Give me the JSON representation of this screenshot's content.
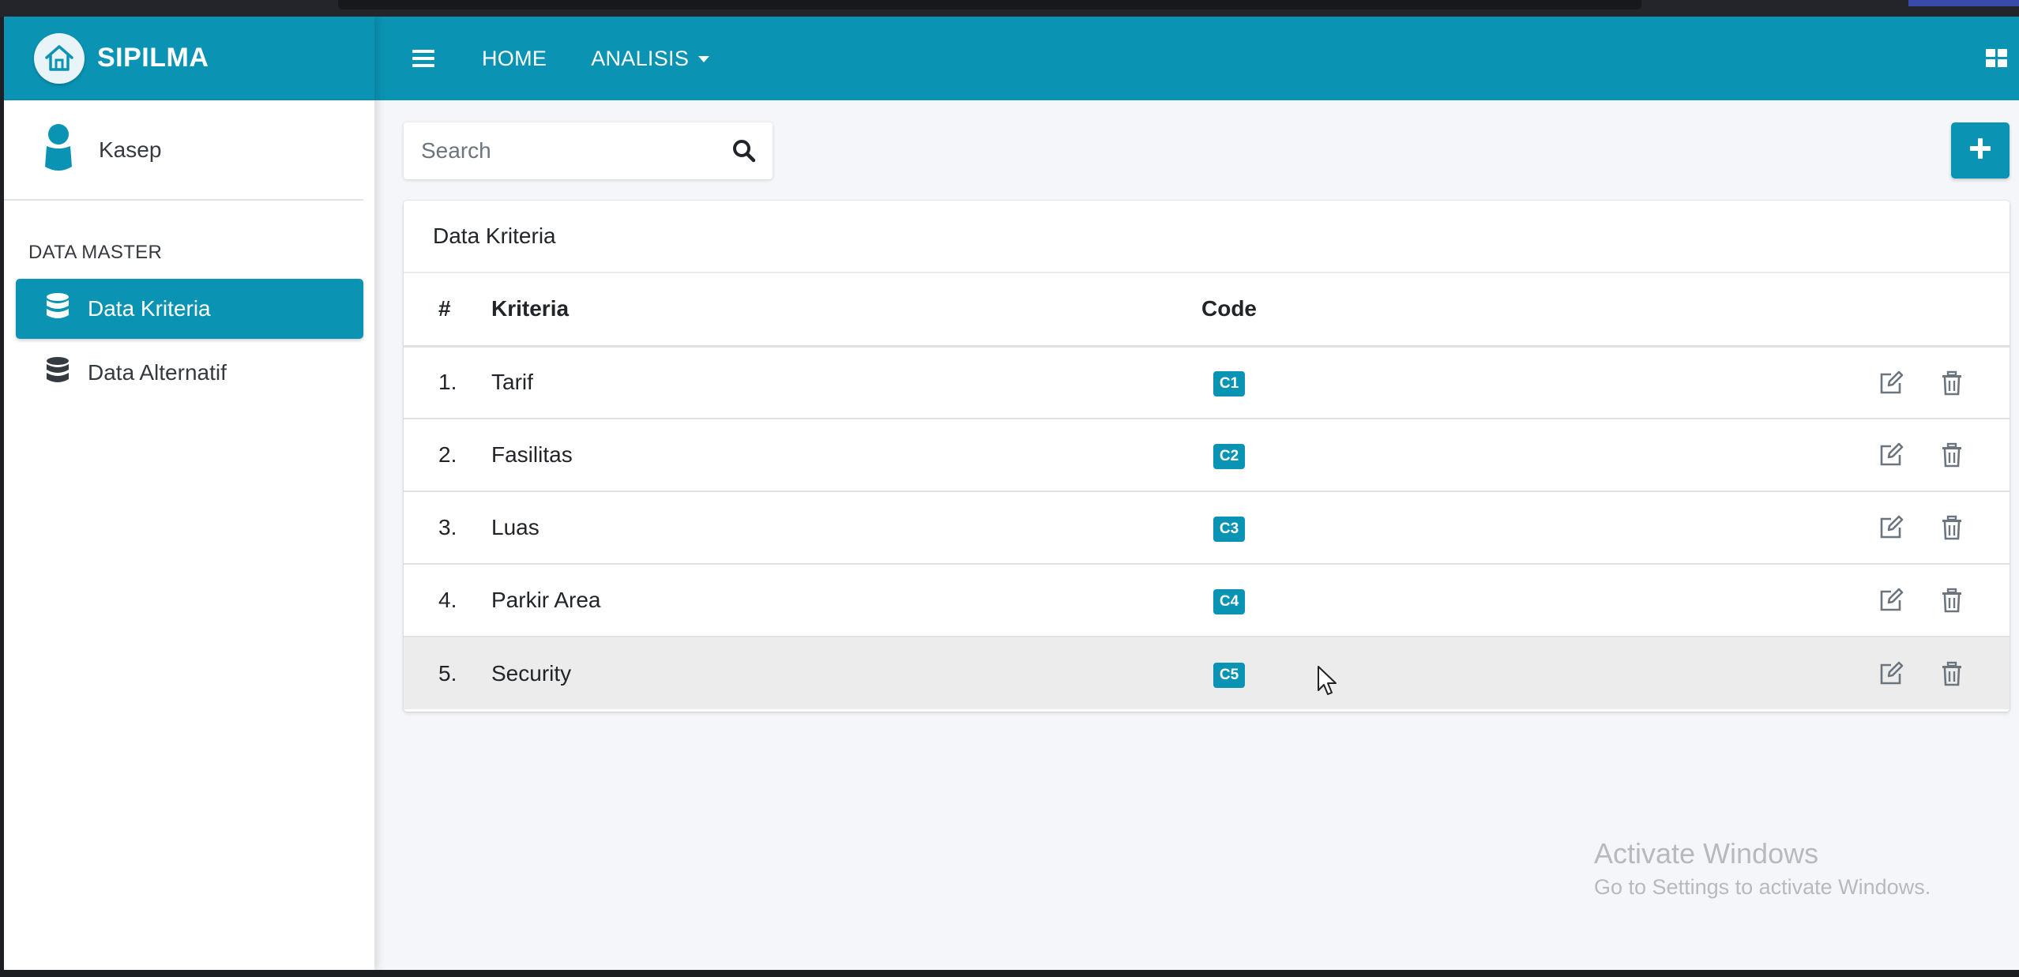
{
  "app": {
    "brand_name": "SIPILMA",
    "accent_color": "#0b93b4"
  },
  "navbar": {
    "menu_icon": "hamburger-icon",
    "home_label": "HOME",
    "analisis_label": "ANALISIS",
    "grid_icon": "grid-icon"
  },
  "sidebar": {
    "user_name": "Kasep",
    "section_header": "DATA MASTER",
    "items": [
      {
        "label": "Data Kriteria",
        "icon": "database-icon",
        "active": true
      },
      {
        "label": "Data Alternatif",
        "icon": "database-icon",
        "active": false
      }
    ]
  },
  "toolbar": {
    "search_placeholder": "Search",
    "search_icon": "search-icon",
    "add_icon": "plus-icon"
  },
  "table": {
    "card_title": "Data Kriteria",
    "headers": [
      "#",
      "Kriteria",
      "Code"
    ],
    "rows": [
      {
        "num": "1.",
        "kriteria": "Tarif",
        "code": "C1"
      },
      {
        "num": "2.",
        "kriteria": "Fasilitas",
        "code": "C2"
      },
      {
        "num": "3.",
        "kriteria": "Luas",
        "code": "C3"
      },
      {
        "num": "4.",
        "kriteria": "Parkir Area",
        "code": "C4"
      },
      {
        "num": "5.",
        "kriteria": "Security",
        "code": "C5"
      }
    ]
  },
  "watermark": {
    "line1": "Activate Windows",
    "line2": "Go to Settings to activate Windows."
  }
}
